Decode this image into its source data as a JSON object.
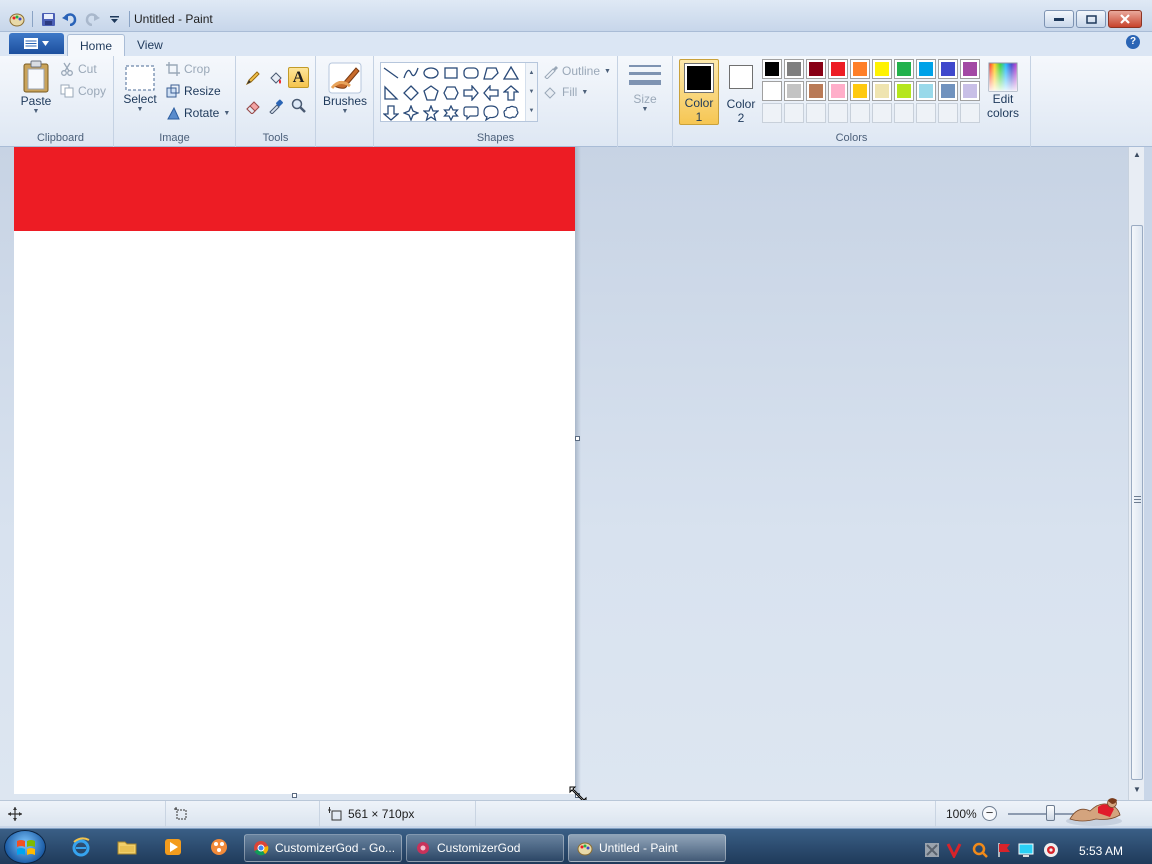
{
  "window": {
    "title": "Untitled - Paint"
  },
  "tabs": [
    {
      "label": "Home",
      "active": true
    },
    {
      "label": "View",
      "active": false
    }
  ],
  "help": "?",
  "ribbon": {
    "clipboard": {
      "label": "Clipboard",
      "paste": "Paste",
      "cut": "Cut",
      "copy": "Copy"
    },
    "image": {
      "label": "Image",
      "select": "Select",
      "crop": "Crop",
      "resize": "Resize",
      "rotate": "Rotate"
    },
    "tools": {
      "label": "Tools",
      "text_glyph": "A"
    },
    "brushes": {
      "label": "Brushes"
    },
    "shapes": {
      "label": "Shapes",
      "outline": "Outline",
      "fill": "Fill"
    },
    "size": {
      "label": "Size"
    },
    "colors": {
      "label": "Colors",
      "color1": "Color",
      "color1_num": "1",
      "color2": "Color",
      "color2_num": "2",
      "color1_value": "#000000",
      "color2_value": "#ffffff",
      "edit": "Edit",
      "edit2": "colors",
      "palette_row1": [
        "#000000",
        "#7f7f7f",
        "#880015",
        "#ed1c24",
        "#ff7f27",
        "#fff200",
        "#22b14c",
        "#00a2e8",
        "#3f48cc",
        "#a349a4"
      ],
      "palette_row2": [
        "#ffffff",
        "#c3c3c3",
        "#b97a57",
        "#ffaec9",
        "#ffc90e",
        "#efe4b0",
        "#b5e61d",
        "#99d9ea",
        "#7092be",
        "#c8bfe7"
      ]
    }
  },
  "canvas": {
    "band_color": "#ed1c24",
    "background": "#ffffff"
  },
  "status": {
    "size_text": "561 × 710px",
    "zoom": "100%",
    "zoom_out": "−",
    "zoom_value_percent": 100
  },
  "taskbar": {
    "tasks": [
      {
        "label": "CustomizerGod - Go...",
        "active": false
      },
      {
        "label": "CustomizerGod",
        "active": false
      },
      {
        "label": "Untitled - Paint",
        "active": true
      }
    ],
    "clock": "5:53 AM"
  }
}
